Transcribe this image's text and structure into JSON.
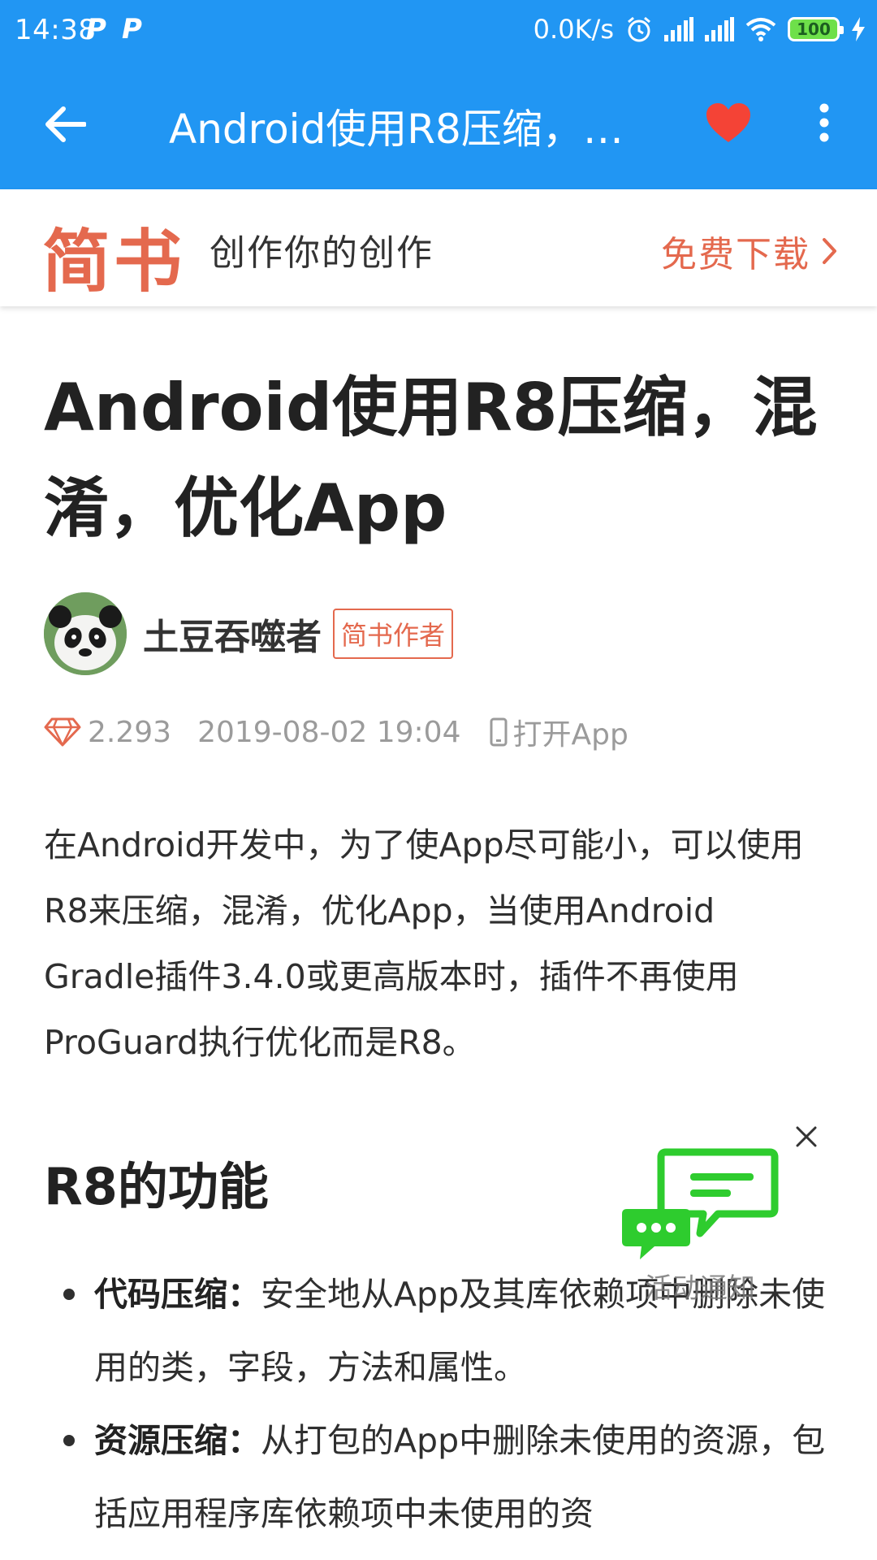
{
  "status_bar": {
    "time": "14:38",
    "net_speed": "0.0K/s",
    "battery": "100"
  },
  "app_bar": {
    "title": "Android使用R8压缩，…"
  },
  "banner": {
    "logo": "简书",
    "slogan": "创作你的创作",
    "download_label": "免费下载"
  },
  "article": {
    "title": "Android使用R8压缩，混淆，优化App",
    "author": {
      "name": "土豆吞噬者",
      "badge": "简书作者"
    },
    "meta": {
      "score": "2.293",
      "date": "2019-08-02 19:04",
      "open_app": "打开App"
    },
    "intro": "在Android开发中，为了使App尽可能小，可以使用R8来压缩，混淆，优化App，当使用Android Gradle插件3.4.0或更高版本时，插件不再使用ProGuard执行优化而是R8。",
    "section_title": "R8的功能",
    "bullets": [
      {
        "term": "代码压缩",
        "sep": "：",
        "text": "安全地从App及其库依赖项中删除未使用的类，字段，方法和属性。"
      },
      {
        "term": "资源压缩",
        "sep": "：",
        "text": "从打包的App中删除未使用的资源，包括应用程序库依赖项中未使用的资"
      }
    ]
  },
  "notification_widget": {
    "label": "活动通知"
  },
  "colors": {
    "primary": "#2196f3",
    "accent": "#e4694e",
    "heart": "#f44336",
    "widget_green": "#2ecc2e"
  }
}
